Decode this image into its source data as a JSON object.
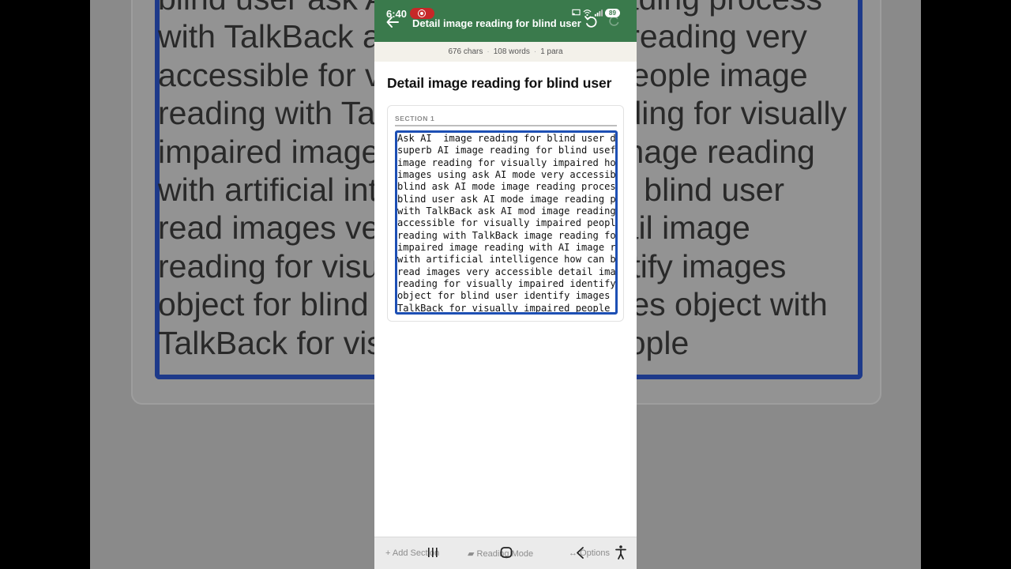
{
  "background_zoom": {
    "lines": [
      "blind user ask AI mode image reading process",
      "with TalkBack ask AI mod image reading very",
      "accessible for visually impaired people image",
      "reading with TalkBack image reading for visually",
      "impaired image reading with AI image reading",
      "with artificial intelligence how can blind user",
      "read images very accessible detail image",
      "reading for visually impaired identify images",
      "object for blind user identify images object with",
      "TalkBack for visually impaired people"
    ]
  },
  "status_bar": {
    "time": "6:40",
    "battery": "89"
  },
  "app_bar": {
    "title": "Detail image reading for blind user"
  },
  "stats": {
    "chars": "676 chars",
    "words": "108 words",
    "paras": "1 para"
  },
  "document": {
    "title": "Detail image reading for blind user",
    "section_label": "SECTION 1",
    "lines": [
      "Ask AI  image reading for blind user detail",
      "superb AI image reading for blind useful AI",
      "image reading for visually impaired how to read",
      "images using ask AI mode very accessible for",
      "blind ask AI mode image reading process for",
      "blind user ask AI mode image reading process",
      "with TalkBack ask AI mod image reading very",
      "accessible for visually impaired people image",
      "reading with TalkBack image reading for visually",
      "impaired image reading with AI image reading",
      "with artificial intelligence how can blind user",
      "read images very accessible detail image",
      "reading for visually impaired identify images",
      "object for blind user identify images object with",
      "TalkBack for visually impaired people"
    ]
  },
  "bottom_bar": {
    "add_section": "Add Section",
    "reading_mode": "Reading Mode",
    "options": "Options"
  },
  "colors": {
    "app_bar": "#3a7a4c",
    "textbox_border": "#1d4fb4",
    "stats_bg": "#f3f1ea"
  },
  "icons": {
    "back": "arrow-left-icon",
    "undo": "undo-icon",
    "redo": "redo-icon",
    "nav_recents": "recents-icon",
    "nav_home": "home-icon",
    "nav_back": "back-chevron-icon",
    "accessibility": "accessibility-icon"
  }
}
